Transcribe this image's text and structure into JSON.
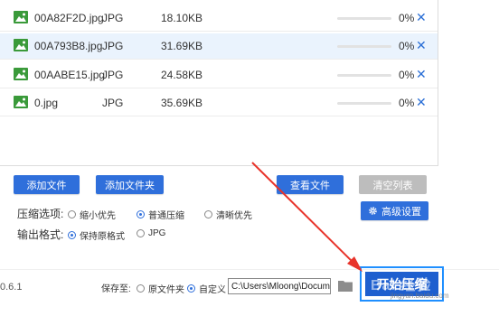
{
  "files": [
    {
      "name": "00A82F2D.jpg",
      "type": "JPG",
      "size": "18.10KB",
      "progress": 0,
      "percent": "0%",
      "delete": "✕",
      "icon": "image-file-icon"
    },
    {
      "name": "00A793B8.jpg",
      "type": "JPG",
      "size": "31.69KB",
      "progress": 0,
      "percent": "0%",
      "delete": "✕",
      "icon": "image-file-icon"
    },
    {
      "name": "00AABE15.jpg",
      "type": "JPG",
      "size": "24.58KB",
      "progress": 0,
      "percent": "0%",
      "delete": "✕",
      "icon": "image-file-icon"
    },
    {
      "name": "0.jpg",
      "type": "JPG",
      "size": "35.69KB",
      "progress": 0,
      "percent": "0%",
      "delete": "✕",
      "icon": "image-file-icon"
    }
  ],
  "toolbar": {
    "add_file": "添加文件",
    "add_folder": "添加文件夹",
    "view_file": "查看文件",
    "clear_list": "清空列表"
  },
  "compression": {
    "label": "压缩选项:",
    "options": [
      "缩小优先",
      "普通压缩",
      "清晰优先"
    ],
    "selected": "普通压缩"
  },
  "advanced": {
    "label": "高级设置",
    "icon": "gear-icon"
  },
  "output_format": {
    "label": "输出格式:",
    "options": [
      "保持原格式",
      "JPG"
    ],
    "selected": "保持原格式"
  },
  "footer": {
    "version": "0.6.1",
    "save_label": "保存至:",
    "save_options": [
      "原文件夹",
      "自定义"
    ],
    "save_selected": "自定义",
    "path": "C:\\Users\\Mloong\\Documents",
    "folder_icon": "folder-icon",
    "start_label": "开始压缩"
  },
  "watermark": {
    "text": "Bai 经验",
    "sub": "jingyan.baidu.com"
  },
  "colors": {
    "accent": "#2f6fdb",
    "annotation": "#e8332a",
    "highlight": "#1f8fff",
    "file_icon": "#3a9a3a"
  }
}
